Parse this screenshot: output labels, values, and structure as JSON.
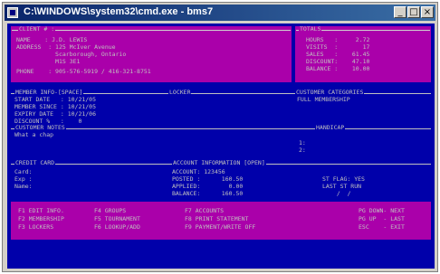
{
  "window": {
    "title": "C:\\WINDOWS\\system32\\cmd.exe - bms7",
    "icon": "console-icon",
    "controls": {
      "minimize": "_",
      "maximize": "□",
      "close": "×"
    }
  },
  "client": {
    "header": "CLIENT # :",
    "name": "NAME    : J.D. LEWIS",
    "address1": "ADDRESS  : 125 McIver Avenue",
    "address2": "           Scarborough, Ontario",
    "address3": "           M1S 3E1",
    "phone": "PHONE    : 905-576-5919 / 416-321-8751"
  },
  "totals": {
    "header": "TOTALS",
    "hours": "HOURS   :     2.72",
    "visits": "VISITS  :       17",
    "sales": "SALES   :    61.45",
    "discount": "DISCOUNT:    47.10",
    "balance": "BALANCE :    10.00"
  },
  "member": {
    "header": "MEMBER INFO-[SPACE]",
    "start": "START DATE   : 10/21/05",
    "since": "MEMBER SINCE : 10/21/05",
    "expiry": "EXPIRY DATE  : 10/21/06",
    "discount": "DISCOUNT %   :    0"
  },
  "locker": {
    "header": "LOCKER"
  },
  "categories": {
    "header": "CUSTOMER CATEGORIES",
    "value": "FULL MEMBERSHIP"
  },
  "notes": {
    "header": "CUSTOMER NOTES",
    "value": "What a chap"
  },
  "handicap": {
    "header": "HANDICAP",
    "line1": "1:",
    "line2": "2:"
  },
  "credit": {
    "header": "CREDIT CARD",
    "card": "Card:",
    "exp": "Exp :",
    "name": "Name:"
  },
  "account": {
    "header": "ACCOUNT INFORMATION [OPEN]",
    "number": "ACCOUNT: 123456",
    "posted": "POSTED :      160.50",
    "posted_flag": "ST FLAG: YES",
    "applied": "APPLIED:        0.00",
    "applied_flag": "LAST ST RUN",
    "balance": "BALANCE:      160.50",
    "balance_flag": "  /  /"
  },
  "function_keys": [
    "F1 EDIT INFO.",
    "F4 GROUPS",
    "F7 ACCOUNTS",
    "PG DOWN- NEXT",
    "F2 MEMBERSHIP",
    "F5 TOURNAMENT",
    "F8 PRINT STATEMENT",
    "PG UP  - LAST",
    "F3 LOCKERS",
    "F6 LOOKUP/ADD",
    "F9 PAYMENT/WRITE OFF",
    "ESC    - EXIT"
  ],
  "colors": {
    "console_bg": "#0000aa",
    "highlight_bg": "#aa00aa",
    "text": "#c0c0c0",
    "titlebar": "#0a246a"
  }
}
